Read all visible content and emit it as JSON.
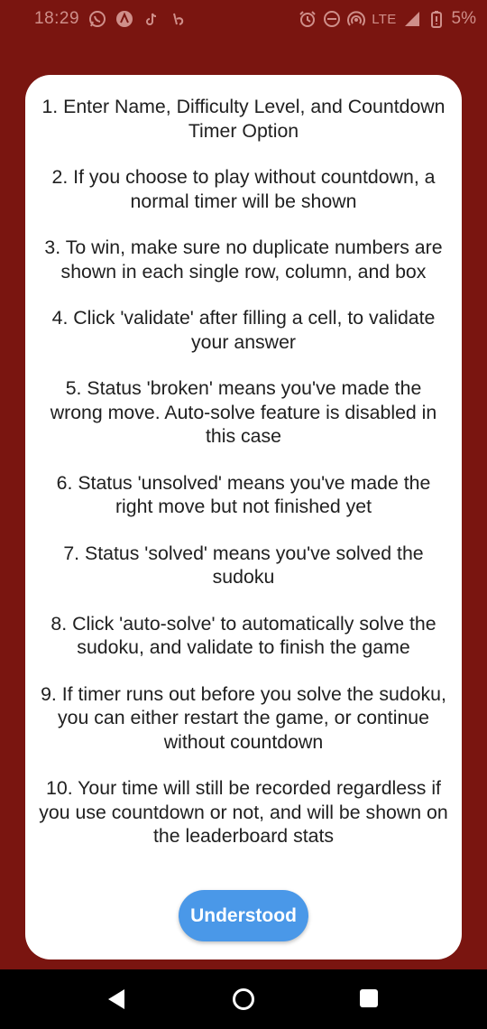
{
  "status_bar": {
    "time": "18:29",
    "network": "LTE",
    "battery": "5%",
    "left_icons": [
      "whatsapp-icon",
      "app-a-icon",
      "tiktok-icon",
      "shopee-icon"
    ],
    "right_icons": [
      "alarm-icon",
      "dnd-icon",
      "hotspot-icon",
      "signal-icon",
      "battery-icon"
    ]
  },
  "dialog": {
    "rules": [
      "1. Enter Name, Difficulty Level, and Countdown Timer Option",
      "2. If you choose to play without countdown, a normal timer will be shown",
      "3. To win, make sure no duplicate numbers are shown in each single row, column, and box",
      "4. Click 'validate' after filling a cell, to validate your answer",
      "5. Status 'broken' means you've made the wrong move. Auto-solve feature is disabled in this case",
      "6. Status 'unsolved' means you've made the right move but not finished yet",
      "7. Status 'solved' means you've solved the sudoku",
      "8. Click 'auto-solve' to automatically solve the sudoku, and validate to finish the game",
      "9. If timer runs out before you solve the sudoku, you can either restart the game, or continue without countdown",
      "10. Your time will still be recorded regardless if you use countdown or not, and will be shown on the leaderboard stats"
    ],
    "button_label": "Understood"
  },
  "navigation": {
    "icons": [
      "back-icon",
      "home-icon",
      "recents-icon"
    ]
  },
  "colors": {
    "background": "#7a1510",
    "dialog": "#ffffff",
    "button": "#4a98e8",
    "text": "#202020"
  }
}
